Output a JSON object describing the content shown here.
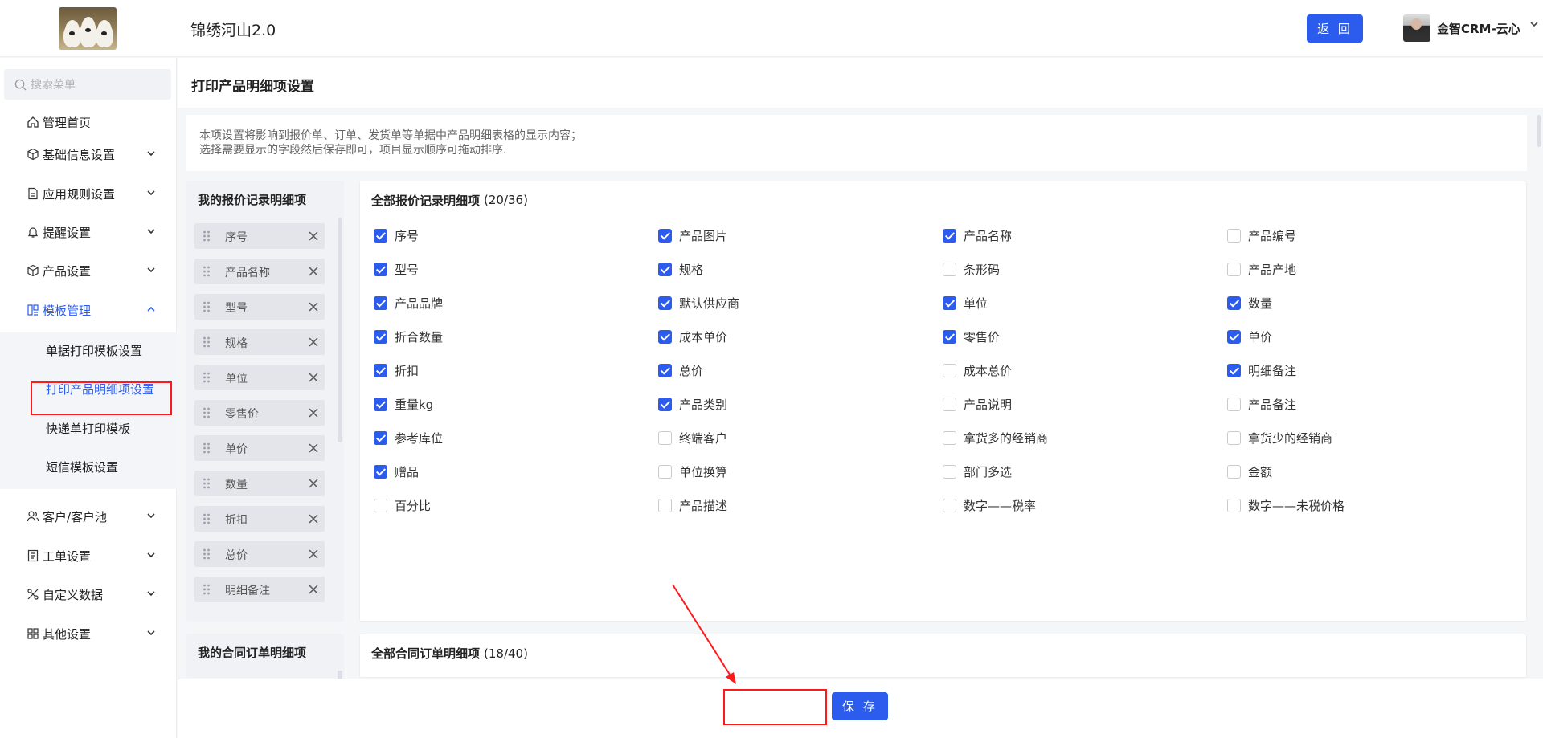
{
  "header": {
    "app_title": "锦绣河山2.0",
    "back_label": "返 回",
    "user_name": "金智CRM-云心"
  },
  "sidebar": {
    "search_placeholder": "搜索菜单",
    "items": [
      {
        "label": "管理首页",
        "icon": "home-icon"
      },
      {
        "label": "基础信息设置",
        "icon": "cube-icon"
      },
      {
        "label": "应用规则设置",
        "icon": "file-icon"
      },
      {
        "label": "提醒设置",
        "icon": "bell-icon"
      },
      {
        "label": "产品设置",
        "icon": "box-icon"
      },
      {
        "label": "模板管理",
        "icon": "template-icon"
      },
      {
        "label": "客户/客户池",
        "icon": "customer-icon"
      },
      {
        "label": "工单设置",
        "icon": "ticket-icon"
      },
      {
        "label": "自定义数据",
        "icon": "custom-data-icon"
      },
      {
        "label": "其他设置",
        "icon": "grid-icon"
      }
    ],
    "sub_items": [
      {
        "label": "单据打印模板设置"
      },
      {
        "label": "打印产品明细项设置"
      },
      {
        "label": "快递单打印模板"
      },
      {
        "label": "短信模板设置"
      }
    ]
  },
  "page": {
    "title": "打印产品明细项设置",
    "notice_line1": "本项设置将影响到报价单、订单、发货单等单据中产品明细表格的显示内容；",
    "notice_line2": "选择需要显示的字段然后保存即可，项目显示顺序可拖动排序."
  },
  "quote": {
    "my_title": "我的报价记录明细项",
    "all_title": "全部报价记录明细项",
    "all_count": "(20/36)",
    "selected": [
      "序号",
      "产品名称",
      "型号",
      "规格",
      "单位",
      "零售价",
      "单价",
      "数量",
      "折扣",
      "总价",
      "明细备注"
    ],
    "options": [
      {
        "label": "序号",
        "checked": true
      },
      {
        "label": "产品图片",
        "checked": true
      },
      {
        "label": "产品名称",
        "checked": true
      },
      {
        "label": "产品编号",
        "checked": false
      },
      {
        "label": "型号",
        "checked": true
      },
      {
        "label": "规格",
        "checked": true
      },
      {
        "label": "条形码",
        "checked": false
      },
      {
        "label": "产品产地",
        "checked": false
      },
      {
        "label": "产品品牌",
        "checked": true
      },
      {
        "label": "默认供应商",
        "checked": true
      },
      {
        "label": "单位",
        "checked": true
      },
      {
        "label": "数量",
        "checked": true
      },
      {
        "label": "折合数量",
        "checked": true
      },
      {
        "label": "成本单价",
        "checked": true
      },
      {
        "label": "零售价",
        "checked": true
      },
      {
        "label": "单价",
        "checked": true
      },
      {
        "label": "折扣",
        "checked": true
      },
      {
        "label": "总价",
        "checked": true
      },
      {
        "label": "成本总价",
        "checked": false
      },
      {
        "label": "明细备注",
        "checked": true
      },
      {
        "label": "重量kg",
        "checked": true
      },
      {
        "label": "产品类别",
        "checked": true
      },
      {
        "label": "产品说明",
        "checked": false
      },
      {
        "label": "产品备注",
        "checked": false
      },
      {
        "label": "参考库位",
        "checked": true
      },
      {
        "label": "终端客户",
        "checked": false
      },
      {
        "label": "拿货多的经销商",
        "checked": false
      },
      {
        "label": "拿货少的经销商",
        "checked": false
      },
      {
        "label": "赠品",
        "checked": true
      },
      {
        "label": "单位换算",
        "checked": false
      },
      {
        "label": "部门多选",
        "checked": false
      },
      {
        "label": "金额",
        "checked": false
      },
      {
        "label": "百分比",
        "checked": false
      },
      {
        "label": "产品描述",
        "checked": false
      },
      {
        "label": "数字——税率",
        "checked": false
      },
      {
        "label": "数字——未税价格",
        "checked": false
      }
    ]
  },
  "contract": {
    "my_title": "我的合同订单明细项",
    "all_title": "全部合同订单明细项",
    "all_count": "(18/40)"
  },
  "footer": {
    "save_label": "保 存"
  },
  "colors": {
    "accent": "#2b5ced",
    "annotation": "#ff1a1a"
  }
}
